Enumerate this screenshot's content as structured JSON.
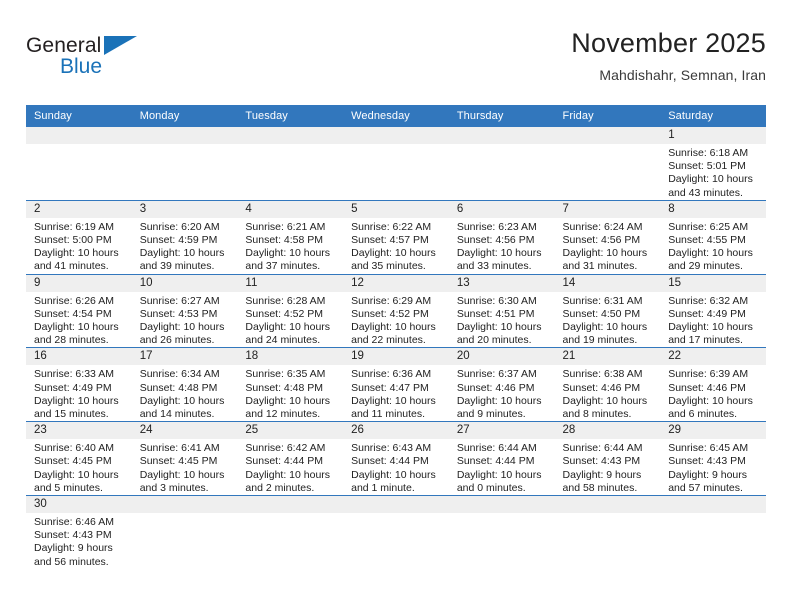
{
  "brand": {
    "line1": "General",
    "line2": "Blue",
    "accent_color": "#1a72b8"
  },
  "header": {
    "title": "November 2025",
    "subtitle": "Mahdishahr, Semnan, Iran"
  },
  "theme": {
    "header_row_bg": "#3277bd",
    "daynum_band_bg": "#efefef",
    "rule_color": "#3277bd",
    "text_color": "#222222"
  },
  "weekdays": [
    "Sunday",
    "Monday",
    "Tuesday",
    "Wednesday",
    "Thursday",
    "Friday",
    "Saturday"
  ],
  "weeks": [
    [
      {
        "day": "",
        "empty": true
      },
      {
        "day": "",
        "empty": true
      },
      {
        "day": "",
        "empty": true
      },
      {
        "day": "",
        "empty": true
      },
      {
        "day": "",
        "empty": true
      },
      {
        "day": "",
        "empty": true
      },
      {
        "day": "1",
        "sunrise": "Sunrise: 6:18 AM",
        "sunset": "Sunset: 5:01 PM",
        "daylight_line1": "Daylight: 10 hours",
        "daylight_line2": "and 43 minutes."
      }
    ],
    [
      {
        "day": "2",
        "sunrise": "Sunrise: 6:19 AM",
        "sunset": "Sunset: 5:00 PM",
        "daylight_line1": "Daylight: 10 hours",
        "daylight_line2": "and 41 minutes."
      },
      {
        "day": "3",
        "sunrise": "Sunrise: 6:20 AM",
        "sunset": "Sunset: 4:59 PM",
        "daylight_line1": "Daylight: 10 hours",
        "daylight_line2": "and 39 minutes."
      },
      {
        "day": "4",
        "sunrise": "Sunrise: 6:21 AM",
        "sunset": "Sunset: 4:58 PM",
        "daylight_line1": "Daylight: 10 hours",
        "daylight_line2": "and 37 minutes."
      },
      {
        "day": "5",
        "sunrise": "Sunrise: 6:22 AM",
        "sunset": "Sunset: 4:57 PM",
        "daylight_line1": "Daylight: 10 hours",
        "daylight_line2": "and 35 minutes."
      },
      {
        "day": "6",
        "sunrise": "Sunrise: 6:23 AM",
        "sunset": "Sunset: 4:56 PM",
        "daylight_line1": "Daylight: 10 hours",
        "daylight_line2": "and 33 minutes."
      },
      {
        "day": "7",
        "sunrise": "Sunrise: 6:24 AM",
        "sunset": "Sunset: 4:56 PM",
        "daylight_line1": "Daylight: 10 hours",
        "daylight_line2": "and 31 minutes."
      },
      {
        "day": "8",
        "sunrise": "Sunrise: 6:25 AM",
        "sunset": "Sunset: 4:55 PM",
        "daylight_line1": "Daylight: 10 hours",
        "daylight_line2": "and 29 minutes."
      }
    ],
    [
      {
        "day": "9",
        "sunrise": "Sunrise: 6:26 AM",
        "sunset": "Sunset: 4:54 PM",
        "daylight_line1": "Daylight: 10 hours",
        "daylight_line2": "and 28 minutes."
      },
      {
        "day": "10",
        "sunrise": "Sunrise: 6:27 AM",
        "sunset": "Sunset: 4:53 PM",
        "daylight_line1": "Daylight: 10 hours",
        "daylight_line2": "and 26 minutes."
      },
      {
        "day": "11",
        "sunrise": "Sunrise: 6:28 AM",
        "sunset": "Sunset: 4:52 PM",
        "daylight_line1": "Daylight: 10 hours",
        "daylight_line2": "and 24 minutes."
      },
      {
        "day": "12",
        "sunrise": "Sunrise: 6:29 AM",
        "sunset": "Sunset: 4:52 PM",
        "daylight_line1": "Daylight: 10 hours",
        "daylight_line2": "and 22 minutes."
      },
      {
        "day": "13",
        "sunrise": "Sunrise: 6:30 AM",
        "sunset": "Sunset: 4:51 PM",
        "daylight_line1": "Daylight: 10 hours",
        "daylight_line2": "and 20 minutes."
      },
      {
        "day": "14",
        "sunrise": "Sunrise: 6:31 AM",
        "sunset": "Sunset: 4:50 PM",
        "daylight_line1": "Daylight: 10 hours",
        "daylight_line2": "and 19 minutes."
      },
      {
        "day": "15",
        "sunrise": "Sunrise: 6:32 AM",
        "sunset": "Sunset: 4:49 PM",
        "daylight_line1": "Daylight: 10 hours",
        "daylight_line2": "and 17 minutes."
      }
    ],
    [
      {
        "day": "16",
        "sunrise": "Sunrise: 6:33 AM",
        "sunset": "Sunset: 4:49 PM",
        "daylight_line1": "Daylight: 10 hours",
        "daylight_line2": "and 15 minutes."
      },
      {
        "day": "17",
        "sunrise": "Sunrise: 6:34 AM",
        "sunset": "Sunset: 4:48 PM",
        "daylight_line1": "Daylight: 10 hours",
        "daylight_line2": "and 14 minutes."
      },
      {
        "day": "18",
        "sunrise": "Sunrise: 6:35 AM",
        "sunset": "Sunset: 4:48 PM",
        "daylight_line1": "Daylight: 10 hours",
        "daylight_line2": "and 12 minutes."
      },
      {
        "day": "19",
        "sunrise": "Sunrise: 6:36 AM",
        "sunset": "Sunset: 4:47 PM",
        "daylight_line1": "Daylight: 10 hours",
        "daylight_line2": "and 11 minutes."
      },
      {
        "day": "20",
        "sunrise": "Sunrise: 6:37 AM",
        "sunset": "Sunset: 4:46 PM",
        "daylight_line1": "Daylight: 10 hours",
        "daylight_line2": "and 9 minutes."
      },
      {
        "day": "21",
        "sunrise": "Sunrise: 6:38 AM",
        "sunset": "Sunset: 4:46 PM",
        "daylight_line1": "Daylight: 10 hours",
        "daylight_line2": "and 8 minutes."
      },
      {
        "day": "22",
        "sunrise": "Sunrise: 6:39 AM",
        "sunset": "Sunset: 4:46 PM",
        "daylight_line1": "Daylight: 10 hours",
        "daylight_line2": "and 6 minutes."
      }
    ],
    [
      {
        "day": "23",
        "sunrise": "Sunrise: 6:40 AM",
        "sunset": "Sunset: 4:45 PM",
        "daylight_line1": "Daylight: 10 hours",
        "daylight_line2": "and 5 minutes."
      },
      {
        "day": "24",
        "sunrise": "Sunrise: 6:41 AM",
        "sunset": "Sunset: 4:45 PM",
        "daylight_line1": "Daylight: 10 hours",
        "daylight_line2": "and 3 minutes."
      },
      {
        "day": "25",
        "sunrise": "Sunrise: 6:42 AM",
        "sunset": "Sunset: 4:44 PM",
        "daylight_line1": "Daylight: 10 hours",
        "daylight_line2": "and 2 minutes."
      },
      {
        "day": "26",
        "sunrise": "Sunrise: 6:43 AM",
        "sunset": "Sunset: 4:44 PM",
        "daylight_line1": "Daylight: 10 hours",
        "daylight_line2": "and 1 minute."
      },
      {
        "day": "27",
        "sunrise": "Sunrise: 6:44 AM",
        "sunset": "Sunset: 4:44 PM",
        "daylight_line1": "Daylight: 10 hours",
        "daylight_line2": "and 0 minutes."
      },
      {
        "day": "28",
        "sunrise": "Sunrise: 6:44 AM",
        "sunset": "Sunset: 4:43 PM",
        "daylight_line1": "Daylight: 9 hours",
        "daylight_line2": "and 58 minutes."
      },
      {
        "day": "29",
        "sunrise": "Sunrise: 6:45 AM",
        "sunset": "Sunset: 4:43 PM",
        "daylight_line1": "Daylight: 9 hours",
        "daylight_line2": "and 57 minutes."
      }
    ],
    [
      {
        "day": "30",
        "sunrise": "Sunrise: 6:46 AM",
        "sunset": "Sunset: 4:43 PM",
        "daylight_line1": "Daylight: 9 hours",
        "daylight_line2": "and 56 minutes."
      },
      {
        "day": "",
        "empty": true
      },
      {
        "day": "",
        "empty": true
      },
      {
        "day": "",
        "empty": true
      },
      {
        "day": "",
        "empty": true
      },
      {
        "day": "",
        "empty": true
      },
      {
        "day": "",
        "empty": true
      }
    ]
  ]
}
